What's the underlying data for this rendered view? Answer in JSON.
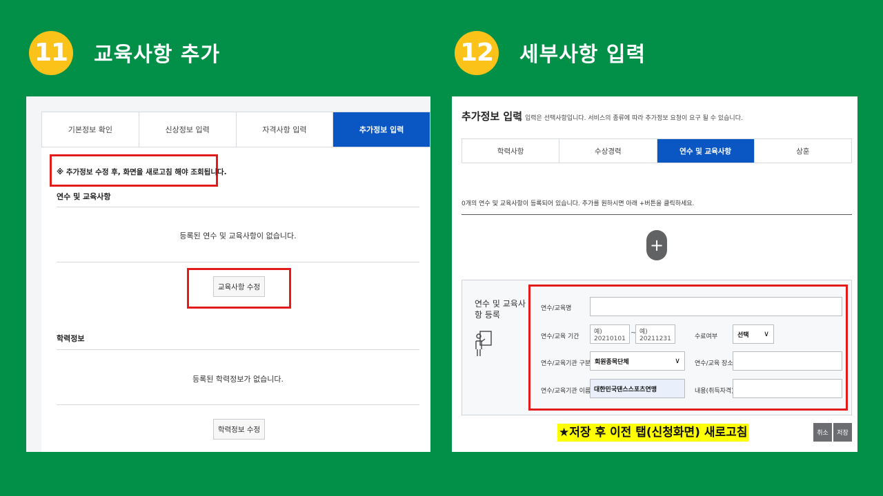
{
  "step11": {
    "number": "11",
    "title": "교육사항 추가"
  },
  "step12": {
    "number": "12",
    "title": "세부사항 입력"
  },
  "left": {
    "tabs": [
      "기본정보 확인",
      "신상정보 입력",
      "자격사항 입력",
      "추가정보 입력"
    ],
    "notice": "※ 추가정보 수정 후, 화면을 새로고침 해야 조회됩니다.",
    "section1_title": "연수 및 교육사항",
    "section1_empty": "등록된 연수 및 교육사항이 없습니다.",
    "section1_button": "교육사항 수정",
    "section2_title": "학력정보",
    "section2_empty": "등록된 학력정보가 없습니다.",
    "section2_button": "학력정보 수정"
  },
  "right": {
    "title": "추가정보 입력",
    "hint": "입력은 선택사항입니다. 서비스의 종류에 따라 추가정보 요청이 요구 될 수 있습니다.",
    "tabs": [
      "학력사항",
      "수상경력",
      "연수 및 교육사항",
      "상훈"
    ],
    "count_text": "0개의 연수 및 교육사항이 등록되어 있습니다. 추가를 원하시면 아래 +버튼을 클릭하세요.",
    "plus": "+",
    "form_title": "연수 및 교육사항 등록",
    "form": {
      "name_label": "연수/교육명",
      "period_label": "연수/교육 기간",
      "start_placeholder": "예) 20210101",
      "end_placeholder": "예) 20211231",
      "tilde": "~",
      "completion_label": "수료여부",
      "completion_value": "선택",
      "org_type_label": "연수/교육기관 구분",
      "org_type_value": "회원종목단체",
      "place_label": "연수/교육 장소",
      "org_name_label": "연수/교육기관 이름",
      "org_name_value": "대한민국댄스스포츠연맹",
      "content_label": "내용(취득자격)"
    },
    "save_note": "★저장 후 이전 탭(신청화면) 새로고침",
    "cancel_button": "취소",
    "save_button": "저장"
  }
}
